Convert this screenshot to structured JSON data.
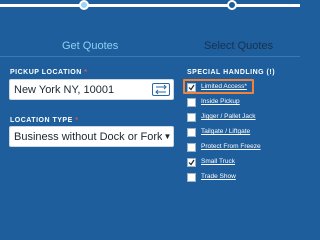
{
  "stepper": {
    "steps": [
      {
        "label": "Get Quotes"
      },
      {
        "label": "Select Quotes"
      }
    ]
  },
  "pickup": {
    "label": "PICKUP LOCATION",
    "required_mark": "*",
    "value": "New York NY, 10001",
    "swap_icon": "swap-arrows-icon"
  },
  "location_type": {
    "label": "LOCATION TYPE",
    "required_mark": "*",
    "value": "Business without Dock or Forklift"
  },
  "special_handling": {
    "label": "SPECIAL HANDLING (!)",
    "options": [
      {
        "label": "Limited Access*",
        "checked": true
      },
      {
        "label": "Inside Pickup",
        "checked": false
      },
      {
        "label": "Jigger / Pallet Jack",
        "checked": false
      },
      {
        "label": "Tailgate / Liftgate",
        "checked": false
      },
      {
        "label": "Protect From Freeze",
        "checked": false
      },
      {
        "label": "Small Truck",
        "checked": true
      },
      {
        "label": "Trade Show",
        "checked": false
      }
    ]
  },
  "colors": {
    "background": "#1e5e9c",
    "active_step": "#8fd0f0",
    "required": "#e8584a",
    "highlight": "#f0833a"
  }
}
